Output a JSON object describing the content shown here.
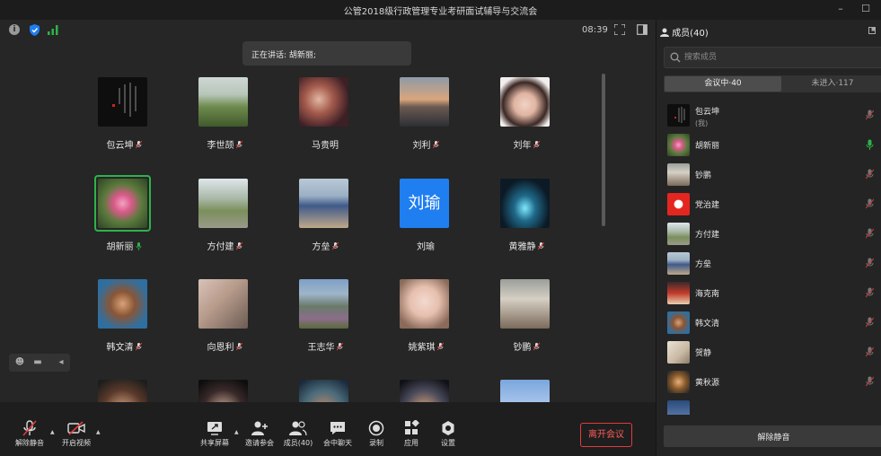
{
  "window": {
    "title": "公管2018级行政管理专业考研面试辅导与交流会"
  },
  "topbar": {
    "time": "08:39"
  },
  "speaking": {
    "text": "正在讲话: 胡新丽;"
  },
  "grid": {
    "tiles": [
      {
        "name": "包云坤",
        "mic": "muted"
      },
      {
        "name": "李世颉",
        "mic": "muted"
      },
      {
        "name": "马贵明",
        "mic": "none"
      },
      {
        "name": "刘利",
        "mic": "muted"
      },
      {
        "name": "刘年",
        "mic": "muted"
      },
      {
        "name": "胡新丽",
        "mic": "active"
      },
      {
        "name": "方付建",
        "mic": "muted"
      },
      {
        "name": "方垒",
        "mic": "muted"
      },
      {
        "name": "刘瑜",
        "mic": "none",
        "letter": "刘瑜"
      },
      {
        "name": "黄雅静",
        "mic": "muted"
      },
      {
        "name": "韩文清",
        "mic": "muted"
      },
      {
        "name": "向恩利",
        "mic": "muted"
      },
      {
        "name": "王志华",
        "mic": "muted"
      },
      {
        "name": "姚紫琪",
        "mic": "muted"
      },
      {
        "name": "钞鹏",
        "mic": "muted"
      }
    ]
  },
  "toolbar": {
    "unmute": "解除静音",
    "start_video": "开启视频",
    "share_screen": "共享屏幕",
    "invite": "邀请参会",
    "members": "成员(40)",
    "chat": "会中聊天",
    "record": "录制",
    "apps": "应用",
    "settings": "设置",
    "leave": "离开会议"
  },
  "sidebar": {
    "title": "成员(40)",
    "search_placeholder": "搜索成员",
    "tab_in_meeting": "会议中·40",
    "tab_not_joined": "未进入·117",
    "members": [
      {
        "name": "包云坤",
        "sub": "(我)",
        "mic": "muted"
      },
      {
        "name": "胡新丽",
        "sub": "",
        "mic": "active"
      },
      {
        "name": "钞鹏",
        "sub": "",
        "mic": "muted"
      },
      {
        "name": "党治建",
        "sub": "",
        "mic": "muted"
      },
      {
        "name": "方付建",
        "sub": "",
        "mic": "muted"
      },
      {
        "name": "方垒",
        "sub": "",
        "mic": "muted"
      },
      {
        "name": "海克南",
        "sub": "",
        "mic": "muted"
      },
      {
        "name": "韩文清",
        "sub": "",
        "mic": "muted"
      },
      {
        "name": "贺静",
        "sub": "",
        "mic": "muted"
      },
      {
        "name": "黄秋源",
        "sub": "",
        "mic": "muted"
      }
    ],
    "unmute_all": "解除静音"
  },
  "colors": {
    "accent_green": "#2db34a",
    "leave_red": "#e23b3b",
    "letter_avatar_blue": "#1f7ef0"
  }
}
